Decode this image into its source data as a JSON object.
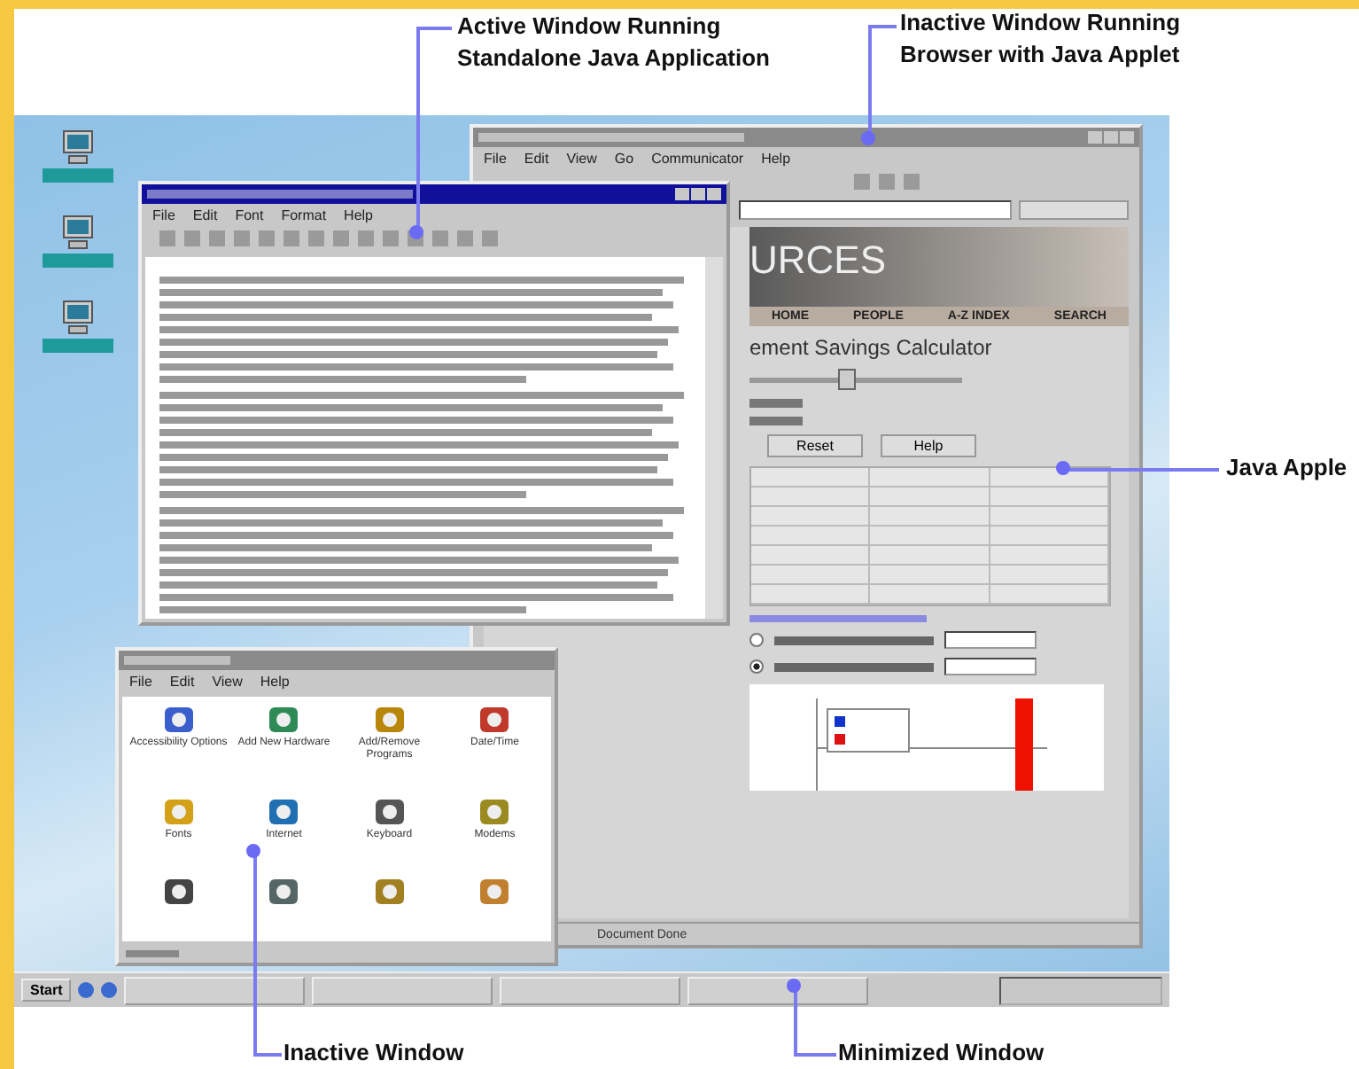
{
  "callouts": [
    {
      "kind": "top",
      "lines": [
        "Active Window Running",
        "Standalone Java Application"
      ]
    },
    {
      "kind": "top",
      "lines": [
        "Inactive Window Running",
        "Browser with Java Applet"
      ]
    },
    {
      "kind": "side",
      "lines": [
        "Java Apple"
      ]
    },
    {
      "kind": "bottom",
      "lines": [
        "Inactive Window"
      ]
    },
    {
      "kind": "bottom",
      "lines": [
        "Minimized Window"
      ]
    }
  ],
  "editor_window": {
    "active": true,
    "menu": [
      "File",
      "Edit",
      "Font",
      "Format",
      "Help"
    ]
  },
  "browser_window": {
    "active": false,
    "menu": [
      "File",
      "Edit",
      "View",
      "Go",
      "Communicator",
      "Help"
    ],
    "banner": "URCES",
    "nav": [
      "HOME",
      "PEOPLE",
      "A-Z INDEX",
      "SEARCH"
    ],
    "heading": "ement Savings Calculator",
    "slider": {
      "level": 0.45
    },
    "radios": [
      {
        "checked": false
      },
      {
        "checked": true
      }
    ],
    "buttons": [
      "Reset",
      "Help"
    ],
    "status": "Document Done"
  },
  "control_panel": {
    "active": false,
    "menu": [
      "File",
      "Edit",
      "View",
      "Help"
    ],
    "items": [
      "Accessibility Options",
      "Add New Hardware",
      "Add/Remove Programs",
      "Date/Time",
      "Fonts",
      "Internet",
      "Keyboard",
      "Modems"
    ]
  },
  "taskbar": {
    "start": "Start"
  }
}
